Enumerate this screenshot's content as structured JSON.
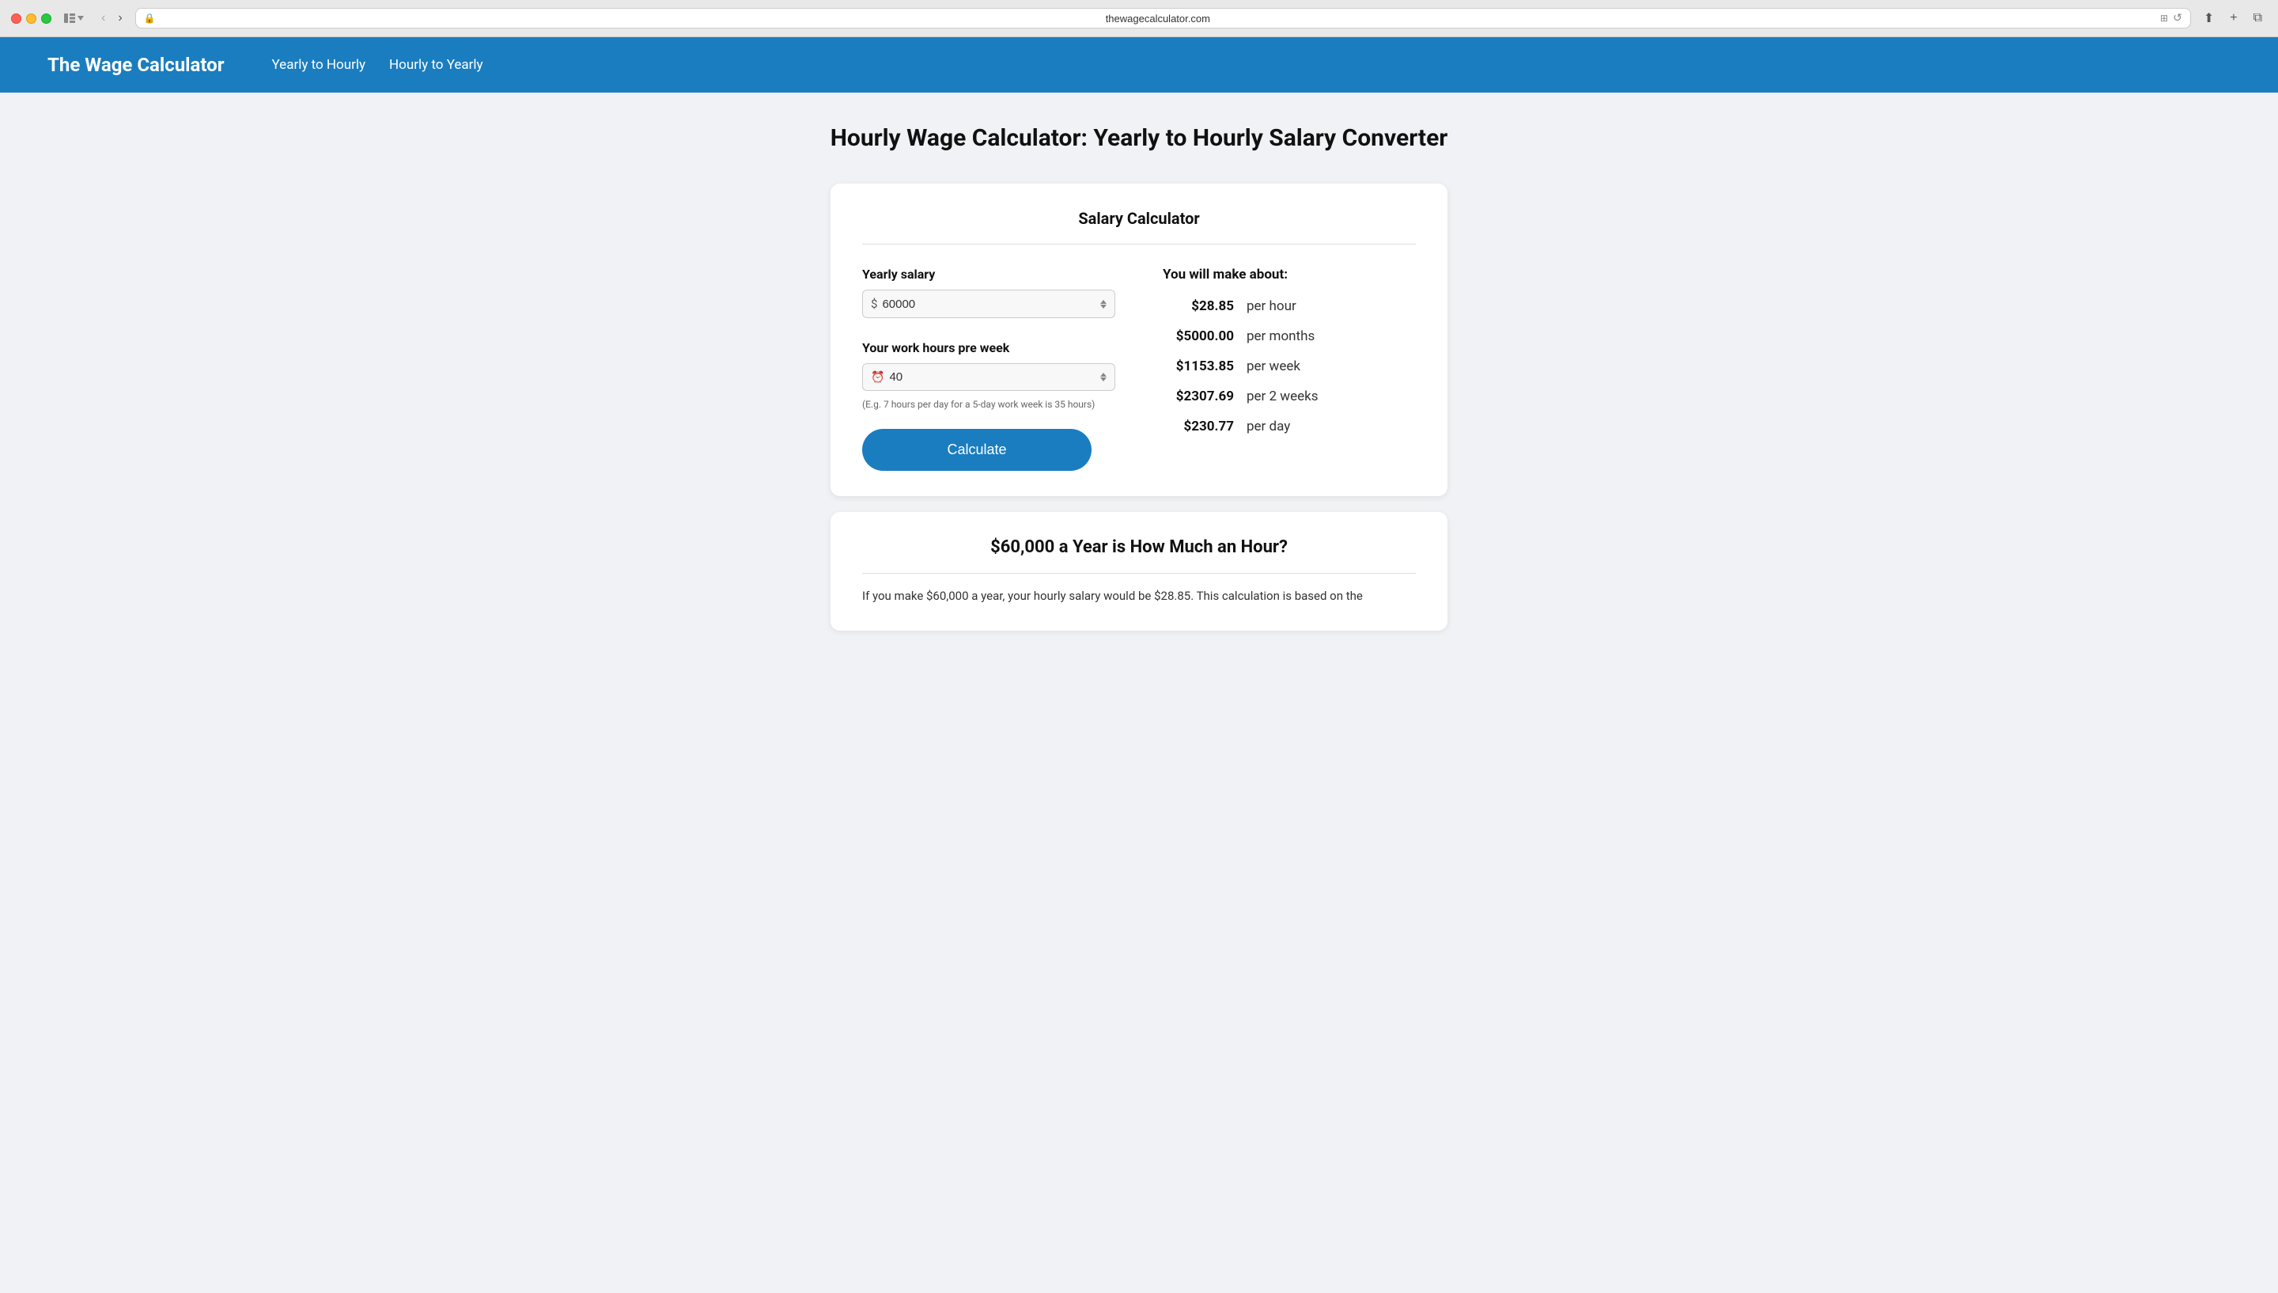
{
  "browser": {
    "url": "thewagecalculator.com",
    "traffic_lights": [
      "red",
      "yellow",
      "green"
    ]
  },
  "site": {
    "logo": "The Wage Calculator",
    "nav": {
      "links": [
        {
          "label": "Yearly to Hourly",
          "id": "yearly-to-hourly"
        },
        {
          "label": "Hourly to Yearly",
          "id": "hourly-to-yearly"
        }
      ]
    }
  },
  "page": {
    "title": "Hourly Wage Calculator:  Yearly to Hourly Salary Converter"
  },
  "calculator_card": {
    "title": "Salary Calculator",
    "yearly_salary_label": "Yearly salary",
    "yearly_salary_value": "60000",
    "yearly_salary_prefix": "$",
    "hours_label": "Your work hours pre week",
    "hours_value": "40",
    "hours_hint": "(E.g. 7 hours per day for a 5-day work week is 35 hours)",
    "calculate_button": "Calculate",
    "results_heading": "You will make about:",
    "results": [
      {
        "amount": "$28.85",
        "period": "per hour"
      },
      {
        "amount": "$5000.00",
        "period": "per months"
      },
      {
        "amount": "$1153.85",
        "period": "per week"
      },
      {
        "amount": "$2307.69",
        "period": "per 2 weeks"
      },
      {
        "amount": "$230.77",
        "period": "per day"
      }
    ]
  },
  "info_card": {
    "title": "$60,000 a Year is How Much an Hour?",
    "text": "If you make $60,000 a year, your hourly salary would be $28.85. This calculation is based on the"
  }
}
